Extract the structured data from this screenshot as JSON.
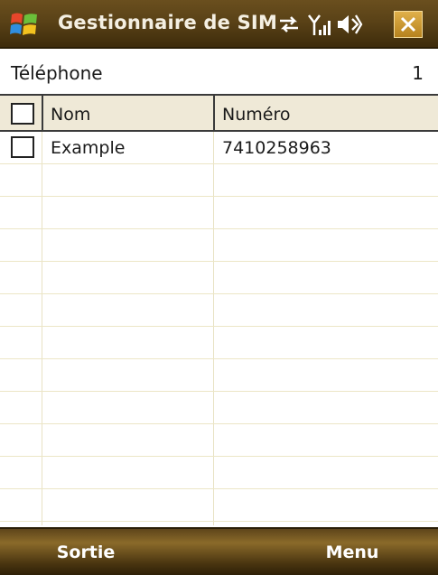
{
  "titlebar": {
    "title": "Gestionnaire de SIM",
    "icons": [
      "windows-start-icon",
      "data-connection-icon",
      "signal-strength-icon",
      "volume-icon",
      "close-icon"
    ],
    "close_label": "✕"
  },
  "subheader": {
    "label": "Téléphone",
    "count": "1"
  },
  "table": {
    "columns": [
      "Nom",
      "Numéro"
    ],
    "rows": [
      {
        "name": "Example",
        "number": "7410258963"
      }
    ]
  },
  "softkeys": {
    "left": "Sortie",
    "right": "Menu"
  },
  "colors": {
    "titlebar": "#5a4217",
    "header_row": "#efe9d7",
    "grid_line": "#ece6c6",
    "close_button": "#d09a34"
  }
}
